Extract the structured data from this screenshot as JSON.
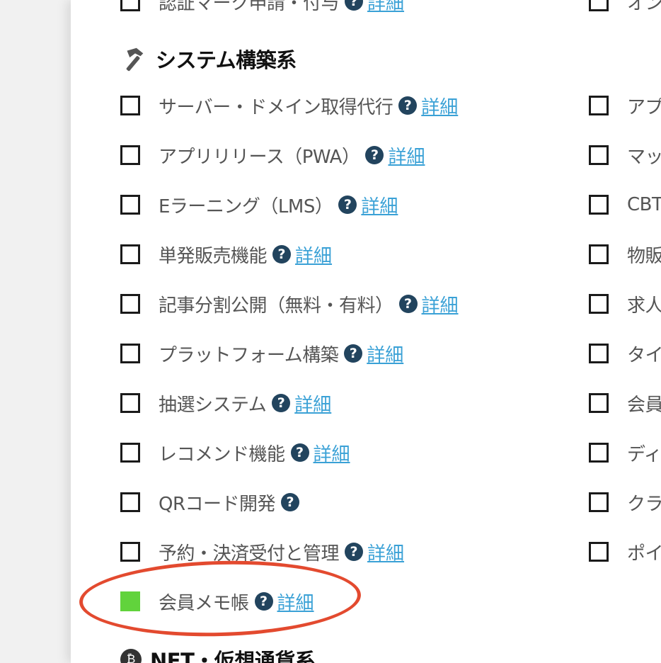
{
  "top_row": {
    "left_label": "認証マーク申請・付与",
    "detail_label": "詳細",
    "right_label": "オン"
  },
  "section": {
    "icon": "hammer-icon",
    "title": "システム構築系"
  },
  "left_items": [
    {
      "label": "サーバー・ドメイン取得代行",
      "detail": "詳細",
      "checked": false
    },
    {
      "label": "アプリリリース（PWA）",
      "detail": "詳細",
      "checked": false
    },
    {
      "label": "Eラーニング（LMS）",
      "detail": "詳細",
      "checked": false
    },
    {
      "label": "単発販売機能",
      "detail": "詳細",
      "checked": false
    },
    {
      "label": "記事分割公開（無料・有料）",
      "detail": "詳細",
      "checked": false
    },
    {
      "label": "プラットフォーム構築",
      "detail": "詳細",
      "checked": false
    },
    {
      "label": "抽選システム",
      "detail": "詳細",
      "checked": false
    },
    {
      "label": "レコメンド機能",
      "detail": "詳細",
      "checked": false
    },
    {
      "label": "QRコード開発",
      "detail": "",
      "checked": false
    },
    {
      "label": "予約・決済受付と管理",
      "detail": "詳細",
      "checked": false
    },
    {
      "label": "会員メモ帳",
      "detail": "詳細",
      "checked": true
    }
  ],
  "right_items": [
    {
      "label": "アプ"
    },
    {
      "label": "マッ"
    },
    {
      "label": "CBT"
    },
    {
      "label": "物販"
    },
    {
      "label": "求人"
    },
    {
      "label": "タイ"
    },
    {
      "label": "会員"
    },
    {
      "label": "ディ"
    },
    {
      "label": "クラ"
    },
    {
      "label": "ポイ"
    }
  ],
  "next_section": {
    "icon": "bitcoin-icon",
    "title": "NFT・仮想通貨系"
  },
  "colors": {
    "checked": "#61d33c",
    "link": "#3aa1d6",
    "help_icon": "#22445e",
    "highlight_ellipse": "#e34a2f"
  }
}
